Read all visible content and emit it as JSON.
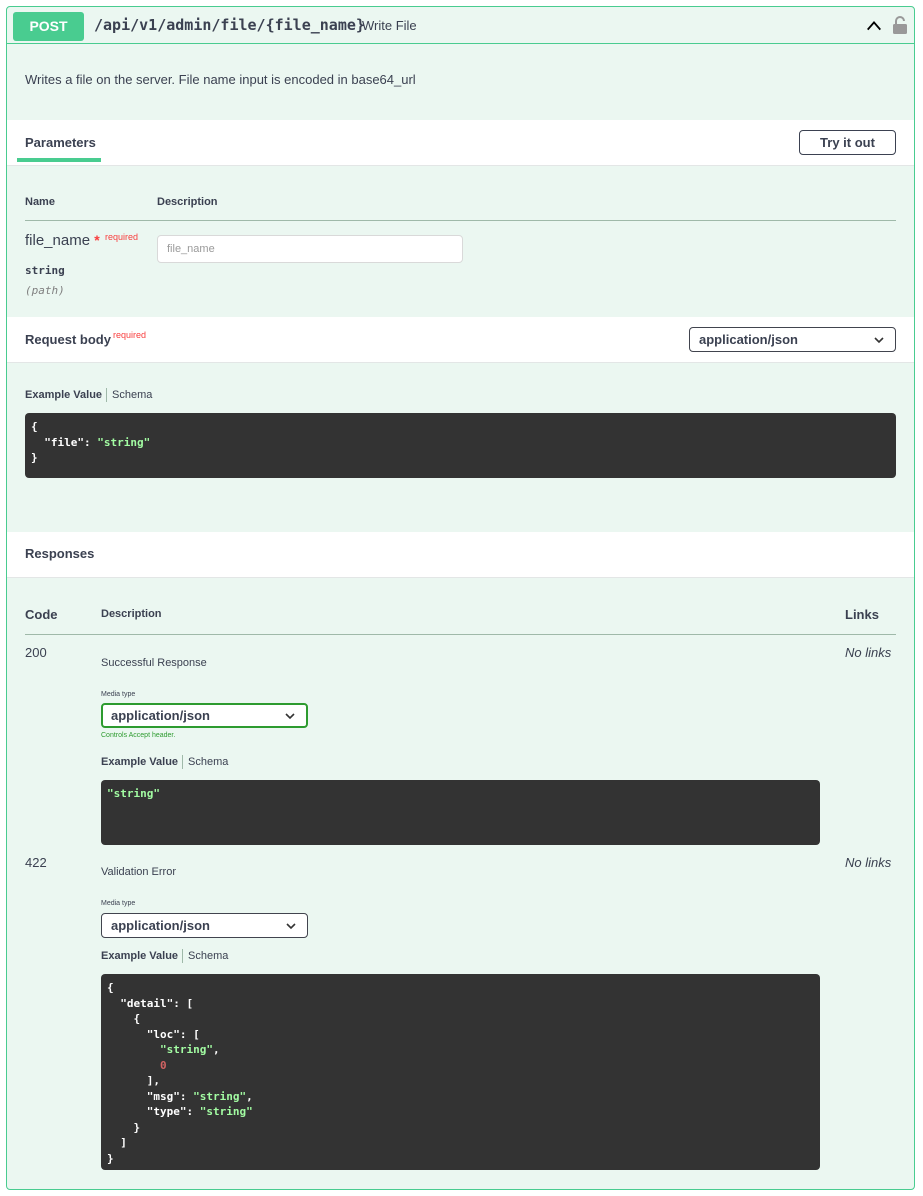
{
  "summary": {
    "method": "POST",
    "path": "/api/v1/admin/file/{file_name}",
    "description": "Write File"
  },
  "description": "Writes a file on the server. File name input is encoded in base64_url",
  "parameters": {
    "title": "Parameters",
    "try_label": "Try it out",
    "col_name": "Name",
    "col_description": "Description",
    "items": [
      {
        "name": "file_name",
        "star": "*",
        "required": "required",
        "type": "string",
        "in": "(path)",
        "placeholder": "file_name"
      }
    ]
  },
  "request_body": {
    "title": "Request body",
    "required": "required",
    "content_type": "application/json",
    "tab_example": "Example Value",
    "tab_schema": "Schema",
    "example_lines": [
      [
        {
          "t": "{",
          "c": "p"
        }
      ],
      [
        {
          "t": "  \"file\"",
          "c": "p"
        },
        {
          "t": ": ",
          "c": "p"
        },
        {
          "t": "\"string\"",
          "c": "s"
        }
      ],
      [
        {
          "t": "}",
          "c": "p"
        }
      ]
    ]
  },
  "responses": {
    "title": "Responses",
    "col_code": "Code",
    "col_description": "Description",
    "col_links": "Links",
    "items": [
      {
        "code": "200",
        "description": "Successful Response",
        "media_type_label": "Media type",
        "media_type": "application/json",
        "controls": "Controls Accept header.",
        "tab_example": "Example Value",
        "tab_schema": "Schema",
        "links": "No links",
        "example_lines": [
          [
            {
              "t": "\"string\"",
              "c": "s"
            }
          ]
        ]
      },
      {
        "code": "422",
        "description": "Validation Error",
        "media_type_label": "Media type",
        "media_type": "application/json",
        "tab_example": "Example Value",
        "tab_schema": "Schema",
        "links": "No links",
        "example_lines": [
          [
            {
              "t": "{",
              "c": "p"
            }
          ],
          [
            {
              "t": "  \"detail\"",
              "c": "p"
            },
            {
              "t": ": [",
              "c": "p"
            }
          ],
          [
            {
              "t": "    {",
              "c": "p"
            }
          ],
          [
            {
              "t": "      \"loc\"",
              "c": "p"
            },
            {
              "t": ": [",
              "c": "p"
            }
          ],
          [
            {
              "t": "        ",
              "c": "p"
            },
            {
              "t": "\"string\"",
              "c": "s"
            },
            {
              "t": ",",
              "c": "p"
            }
          ],
          [
            {
              "t": "        ",
              "c": "p"
            },
            {
              "t": "0",
              "c": "n"
            }
          ],
          [
            {
              "t": "      ],",
              "c": "p"
            }
          ],
          [
            {
              "t": "      \"msg\"",
              "c": "p"
            },
            {
              "t": ": ",
              "c": "p"
            },
            {
              "t": "\"string\"",
              "c": "s"
            },
            {
              "t": ",",
              "c": "p"
            }
          ],
          [
            {
              "t": "      \"type\"",
              "c": "p"
            },
            {
              "t": ": ",
              "c": "p"
            },
            {
              "t": "\"string\"",
              "c": "s"
            }
          ],
          [
            {
              "t": "    }",
              "c": "p"
            }
          ],
          [
            {
              "t": "  ]",
              "c": "p"
            }
          ],
          [
            {
              "t": "}",
              "c": "p"
            }
          ]
        ]
      }
    ]
  },
  "colors": {
    "accent": "#49cc90",
    "background": "#ebf7f1",
    "code_bg": "#333333",
    "string": "#a2fca2",
    "number": "#d36363",
    "required": "#f93e3e"
  },
  "icons": {
    "collapse": "chevron-up-icon",
    "lock": "lock-icon",
    "select": "chevron-down-icon"
  }
}
